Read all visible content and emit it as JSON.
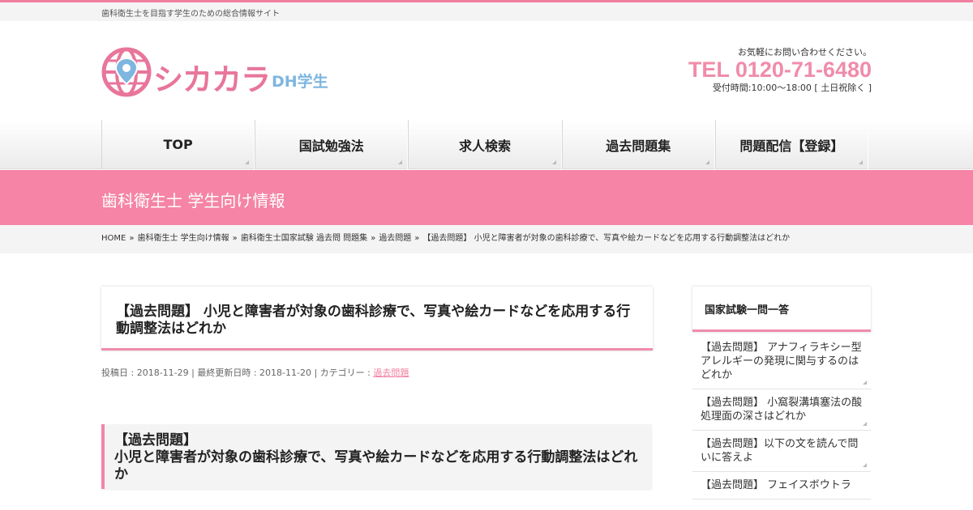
{
  "site": {
    "tagline": "歯科衛生士を目指す学生のための総合情報サイト",
    "logo_text": "シカカラ",
    "logo_sub": "DH学生"
  },
  "contact": {
    "note": "お気軽にお問い合わせください。",
    "tel": "TEL 0120-71-6480",
    "hours": "受付時間:10:00～18:00 [ 土日祝除く ]"
  },
  "nav": {
    "items": [
      {
        "label": "TOP"
      },
      {
        "label": "国試勉強法"
      },
      {
        "label": "求人検索"
      },
      {
        "label": "過去問題集"
      },
      {
        "label": "問題配信【登録】"
      }
    ]
  },
  "banner": {
    "title": "歯科衛生士 学生向け情報"
  },
  "breadcrumb": {
    "items": [
      "HOME",
      "歯科衛生士 学生向け情報",
      "歯科衛生士国家試験 過去問 問題集",
      "過去問題",
      "【過去問題】 小児と障害者が対象の歯科診療で、写真や絵カードなどを応用する行動調整法はどれか"
    ],
    "separator": "»"
  },
  "post": {
    "title": "【過去問題】 小児と障害者が対象の歯科診療で、写真や絵カードなどを応用する行動調整法はどれか",
    "meta_prefix": "投稿日 : 2018-11-29 | 最終更新日時 : 2018-11-20 | カテゴリー : ",
    "category": "過去問題",
    "heading_line1": "【過去問題】",
    "heading_line2": "小児と障害者が対象の歯科診療で、写真や絵カードなどを応用する行動調整法はどれか"
  },
  "sidebar": {
    "title": "国家試験一問一答",
    "items": [
      {
        "label": "【過去問題】 アナフィラキシー型アレルギーの発現に関与するのはどれか"
      },
      {
        "label": "【過去問題】 小窩裂溝填塞法の酸処理面の深さはどれか"
      },
      {
        "label": "【過去問題】以下の文を読んで問いに答えよ"
      },
      {
        "label": "【過去問題】 フェイスボウトラ"
      }
    ]
  },
  "colors": {
    "accent": "#f584a6",
    "tel": "#f08cab",
    "logo_sub": "#7eb6e0"
  }
}
